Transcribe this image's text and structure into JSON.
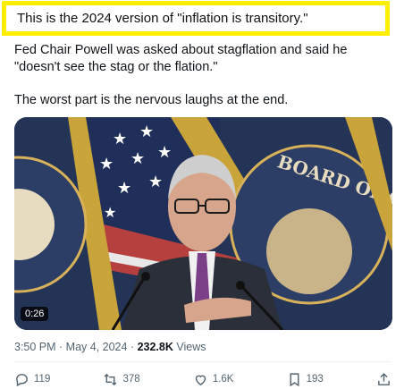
{
  "banner": {
    "text": "This is the 2024 version of \"inflation is transitory.\""
  },
  "tweet": {
    "line1": "Fed Chair Powell was asked about stagflation and said he \"doesn't see the stag or the flation.\"",
    "line2": "The worst part is the nervous laughs at the end."
  },
  "media": {
    "duration": "0:26",
    "seal_text": "BOARD OF GOVERNORS"
  },
  "meta": {
    "time": "3:50 PM",
    "separator": " · ",
    "date": "May 4, 2024",
    "views_count": "232.8K",
    "views_label": " Views"
  },
  "actions": {
    "replies": "119",
    "reposts": "378",
    "likes": "1.6K",
    "bookmarks": "193"
  },
  "icons": [
    "reply-icon",
    "repost-icon",
    "like-icon",
    "bookmark-icon",
    "share-icon"
  ],
  "colors": {
    "banner_border": "#ffee00",
    "muted_text": "#536471",
    "text": "#0f1419"
  }
}
